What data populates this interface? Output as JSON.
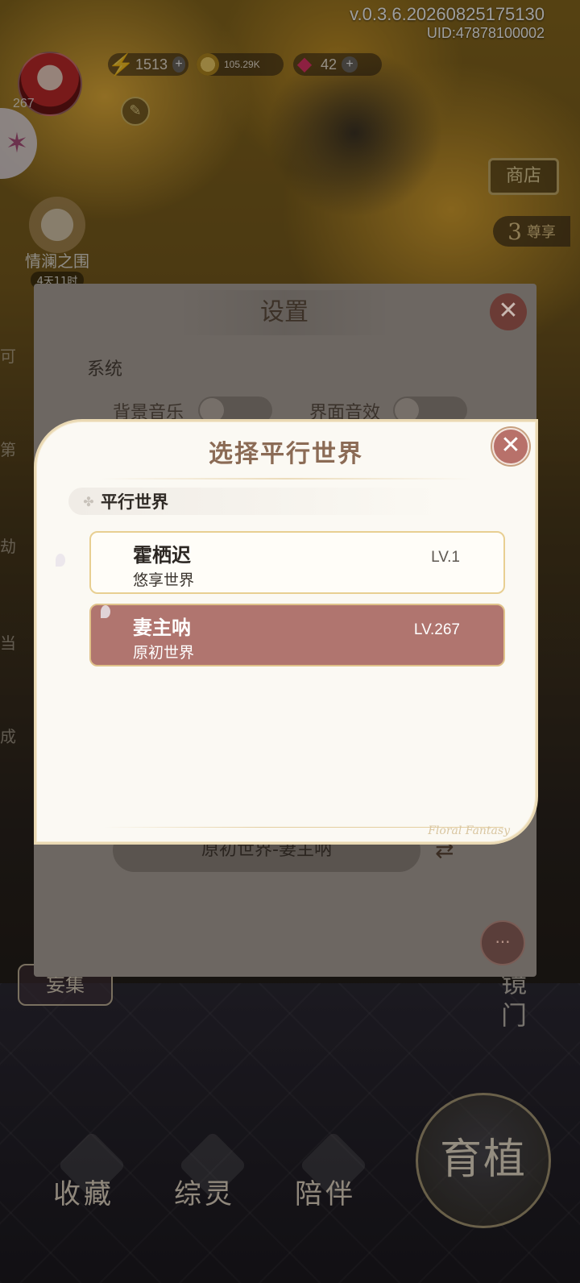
{
  "hud": {
    "version": "v.0.3.6.20260825175130",
    "uid": "UID:47878100002",
    "player_level": "267",
    "energy": "1513",
    "coins": "105.29K",
    "gems": "42"
  },
  "scene": {
    "event_name": "情澜之围",
    "event_timer": "4天11时",
    "shop_label": "商店",
    "vip_number": "3",
    "vip_label": "尊享",
    "mirror_gate_label": "镜门",
    "collect_label": "妄集",
    "side_fragments": [
      "可",
      "第",
      "劫",
      "当",
      "成"
    ]
  },
  "bottom_nav": {
    "items": [
      {
        "label": "收藏"
      },
      {
        "label": "综灵"
      },
      {
        "label": "陪伴"
      }
    ],
    "grow_label": "育植"
  },
  "settings": {
    "title": "设置",
    "section_system": "系统",
    "bgm_label": "背景音乐",
    "sfx_label": "界面音效",
    "current_world": "原初世界-妻主呐"
  },
  "world_dialog": {
    "title": "选择平行世界",
    "section_label": "平行世界",
    "worlds": [
      {
        "name": "霍栖迟",
        "type": "悠享世界",
        "level": "LV.1",
        "selected": false
      },
      {
        "name": "妻主呐",
        "type": "原初世界",
        "level": "LV.267",
        "selected": true
      }
    ],
    "signature": "Floral Fantasy"
  },
  "icons": {
    "close": "✕",
    "energy": "⚡",
    "gem": "◆",
    "plus": "+",
    "switch": "⇄",
    "support": "···"
  },
  "colors": {
    "selected_card": "#b0756f",
    "title_brown": "#8b6b55",
    "close_button": "#b8716a"
  }
}
